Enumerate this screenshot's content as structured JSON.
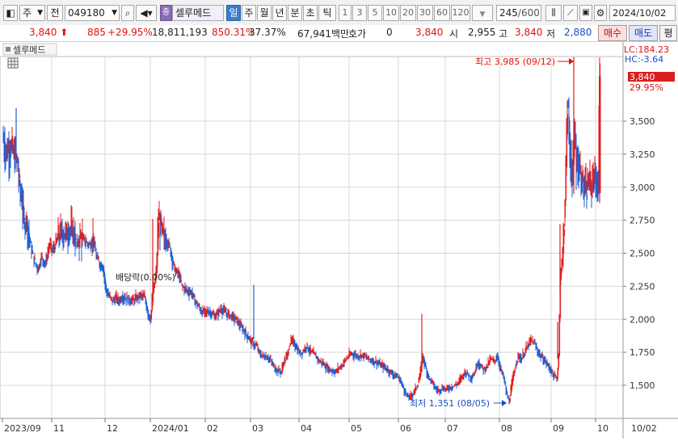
{
  "toolbar": {
    "market": "주",
    "scope": "전",
    "code": "049180",
    "name": "셀루메드",
    "periods": [
      "일",
      "주",
      "월",
      "년",
      "분",
      "초",
      "틱"
    ],
    "active_period": "일",
    "intervals": [
      "1",
      "3",
      "5",
      "10",
      "20",
      "30",
      "60",
      "120"
    ],
    "count": "245",
    "count_total": "/600",
    "date": "2024/10/02"
  },
  "quote": {
    "price": "3,840",
    "change": "885",
    "change_pct": "+29.95%",
    "volume": "18,811,193",
    "volume_ratio": "850.31%",
    "turnover": "37.37%",
    "amount": "67,941백만",
    "hoga_label": "호가",
    "hoga_value": "0",
    "bid": "3,840",
    "open_label": "시",
    "open": "2,955",
    "high_label": "고",
    "high": "3,840",
    "low_label": "저",
    "low": "2,880",
    "buy": "매수",
    "sell": "매도",
    "extra": "평"
  },
  "chart": {
    "legend": "셀루메드",
    "lc": "LC:184.23",
    "hc": "HC:-3.64",
    "last_price": "3,840",
    "last_pct": "29.95%",
    "high_note": "최고 3,985 (09/12)",
    "low_note": "최저 1,351 (08/05)",
    "dividend_note": "배당락(0.00%)",
    "current_date": "10/02",
    "colors": {
      "up": "#e01e1e",
      "down": "#1f5fd0",
      "grid": "#d8d8d8"
    }
  },
  "chart_data": {
    "type": "candlestick",
    "ylim": [
      1250,
      4150
    ],
    "y_ticks": [
      1500,
      1750,
      2000,
      2250,
      2500,
      2750,
      3000,
      3250,
      3500
    ],
    "y_tick_labels": [
      "1,500",
      "1,750",
      "2,000",
      "2,250",
      "2,500",
      "2,750",
      "3,000",
      "3,250",
      "3,500"
    ],
    "x_labels": [
      "2023/09",
      "11",
      "12",
      "2024/01",
      "02",
      "03",
      "04",
      "05",
      "06",
      "07",
      "08",
      "09",
      "10"
    ],
    "close_series": [
      [
        0,
        3380
      ],
      [
        4,
        3270
      ],
      [
        10,
        3300
      ],
      [
        14,
        3250
      ],
      [
        18,
        3200
      ],
      [
        21,
        3000
      ],
      [
        24,
        2900
      ],
      [
        27,
        2700
      ],
      [
        29,
        2780
      ],
      [
        32,
        2650
      ],
      [
        36,
        2520
      ],
      [
        40,
        2430
      ],
      [
        44,
        2380
      ],
      [
        48,
        2470
      ],
      [
        53,
        2420
      ],
      [
        58,
        2560
      ],
      [
        62,
        2520
      ],
      [
        66,
        2580
      ],
      [
        70,
        2640
      ],
      [
        74,
        2660
      ],
      [
        78,
        2640
      ],
      [
        83,
        2680
      ],
      [
        88,
        2660
      ],
      [
        92,
        2560
      ],
      [
        96,
        2620
      ],
      [
        100,
        2600
      ],
      [
        104,
        2580
      ],
      [
        108,
        2560
      ],
      [
        112,
        2620
      ],
      [
        116,
        2470
      ],
      [
        120,
        2420
      ],
      [
        124,
        2400
      ],
      [
        128,
        2220
      ],
      [
        132,
        2170
      ],
      [
        136,
        2140
      ],
      [
        140,
        2160
      ],
      [
        144,
        2140
      ],
      [
        148,
        2170
      ],
      [
        152,
        2160
      ],
      [
        156,
        2150
      ],
      [
        160,
        2140
      ],
      [
        164,
        2150
      ],
      [
        168,
        2170
      ],
      [
        172,
        2180
      ],
      [
        176,
        2160
      ],
      [
        180,
        2040
      ],
      [
        183,
        2000
      ],
      [
        186,
        2200
      ],
      [
        190,
        2350
      ],
      [
        193,
        2750
      ],
      [
        196,
        2700
      ],
      [
        199,
        2620
      ],
      [
        203,
        2600
      ],
      [
        207,
        2540
      ],
      [
        211,
        2420
      ],
      [
        214,
        2360
      ],
      [
        218,
        2340
      ],
      [
        222,
        2250
      ],
      [
        226,
        2230
      ],
      [
        230,
        2210
      ],
      [
        234,
        2200
      ],
      [
        238,
        2140
      ],
      [
        242,
        2100
      ],
      [
        246,
        2060
      ],
      [
        250,
        2050
      ],
      [
        254,
        2060
      ],
      [
        258,
        2050
      ],
      [
        262,
        2020
      ],
      [
        266,
        2040
      ],
      [
        270,
        2080
      ],
      [
        274,
        2060
      ],
      [
        278,
        2040
      ],
      [
        282,
        2030
      ],
      [
        286,
        2010
      ],
      [
        290,
        1990
      ],
      [
        294,
        1950
      ],
      [
        298,
        1920
      ],
      [
        302,
        1880
      ],
      [
        306,
        1850
      ],
      [
        310,
        1810
      ],
      [
        314,
        1800
      ],
      [
        318,
        1740
      ],
      [
        322,
        1720
      ],
      [
        326,
        1720
      ],
      [
        330,
        1700
      ],
      [
        334,
        1660
      ],
      [
        338,
        1620
      ],
      [
        342,
        1610
      ],
      [
        345,
        1600
      ],
      [
        348,
        1680
      ],
      [
        352,
        1720
      ],
      [
        356,
        1830
      ],
      [
        360,
        1830
      ],
      [
        364,
        1780
      ],
      [
        368,
        1740
      ],
      [
        372,
        1760
      ],
      [
        376,
        1800
      ],
      [
        380,
        1760
      ],
      [
        384,
        1740
      ],
      [
        388,
        1720
      ],
      [
        392,
        1680
      ],
      [
        396,
        1670
      ],
      [
        400,
        1640
      ],
      [
        404,
        1620
      ],
      [
        408,
        1610
      ],
      [
        412,
        1600
      ],
      [
        416,
        1630
      ],
      [
        420,
        1650
      ],
      [
        424,
        1690
      ],
      [
        428,
        1720
      ],
      [
        432,
        1740
      ],
      [
        436,
        1730
      ],
      [
        440,
        1720
      ],
      [
        444,
        1730
      ],
      [
        448,
        1720
      ],
      [
        452,
        1700
      ],
      [
        456,
        1690
      ],
      [
        460,
        1680
      ],
      [
        464,
        1670
      ],
      [
        468,
        1650
      ],
      [
        472,
        1640
      ],
      [
        476,
        1620
      ],
      [
        480,
        1600
      ],
      [
        484,
        1580
      ],
      [
        488,
        1570
      ],
      [
        492,
        1540
      ],
      [
        496,
        1480
      ],
      [
        500,
        1420
      ],
      [
        504,
        1410
      ],
      [
        508,
        1440
      ],
      [
        512,
        1480
      ],
      [
        516,
        1560
      ],
      [
        520,
        1720
      ],
      [
        524,
        1620
      ],
      [
        528,
        1550
      ],
      [
        532,
        1520
      ],
      [
        536,
        1470
      ],
      [
        540,
        1460
      ],
      [
        544,
        1480
      ],
      [
        548,
        1470
      ],
      [
        552,
        1480
      ],
      [
        556,
        1490
      ],
      [
        560,
        1500
      ],
      [
        564,
        1520
      ],
      [
        568,
        1560
      ],
      [
        572,
        1600
      ],
      [
        576,
        1580
      ],
      [
        580,
        1560
      ],
      [
        584,
        1590
      ],
      [
        588,
        1680
      ],
      [
        592,
        1640
      ],
      [
        596,
        1620
      ],
      [
        600,
        1650
      ],
      [
        604,
        1700
      ],
      [
        608,
        1680
      ],
      [
        612,
        1720
      ],
      [
        616,
        1630
      ],
      [
        620,
        1560
      ],
      [
        624,
        1420
      ],
      [
        627,
        1380
      ],
      [
        630,
        1500
      ],
      [
        634,
        1640
      ],
      [
        638,
        1720
      ],
      [
        642,
        1700
      ],
      [
        646,
        1750
      ],
      [
        650,
        1800
      ],
      [
        654,
        1840
      ],
      [
        658,
        1820
      ],
      [
        662,
        1760
      ],
      [
        666,
        1720
      ],
      [
        670,
        1690
      ],
      [
        674,
        1660
      ],
      [
        678,
        1620
      ],
      [
        682,
        1570
      ],
      [
        686,
        1550
      ],
      [
        688,
        1720
      ],
      [
        690,
        2300
      ],
      [
        693,
        2500
      ],
      [
        696,
        2900
      ],
      [
        699,
        3650
      ],
      [
        702,
        3300
      ],
      [
        705,
        3050
      ],
      [
        708,
        3400
      ],
      [
        710,
        3200
      ],
      [
        713,
        3150
      ],
      [
        716,
        3100
      ],
      [
        719,
        3000
      ],
      [
        722,
        2950
      ],
      [
        725,
        3050
      ],
      [
        728,
        3000
      ],
      [
        731,
        3100
      ],
      [
        734,
        3050
      ],
      [
        737,
        2980
      ],
      [
        739,
        3840
      ]
    ],
    "high": {
      "value": 3985,
      "date": "09/12"
    },
    "low": {
      "value": 1351,
      "date": "08/05"
    },
    "last": 3840
  }
}
